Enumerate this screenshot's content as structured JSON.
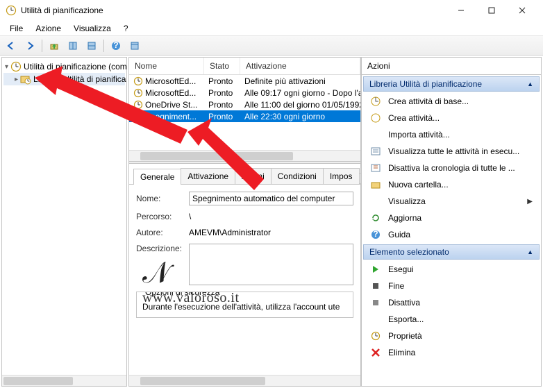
{
  "window": {
    "title": "Utilità di pianificazione"
  },
  "menu": {
    "file": "File",
    "azione": "Azione",
    "visualizza": "Visualizza",
    "help": "?"
  },
  "tree": {
    "root": "Utilità di pianificazione (comp",
    "lib": "Libreria Utilità di pianifica"
  },
  "list": {
    "cols": {
      "nome": "Nome",
      "stato": "Stato",
      "attivazione": "Attivazione"
    },
    "rows": [
      {
        "nome": "MicrosoftEd...",
        "stato": "Pronto",
        "attivazione": "Definite più attivazioni"
      },
      {
        "nome": "MicrosoftEd...",
        "stato": "Pronto",
        "attivazione": "Alle 09:17 ogni giorno - Dopo l'a"
      },
      {
        "nome": "OneDrive St...",
        "stato": "Pronto",
        "attivazione": "Alle 11:00 del giorno 01/05/1992"
      },
      {
        "nome": "Spegniment...",
        "stato": "Pronto",
        "attivazione": "Alle 22:30 ogni giorno"
      }
    ]
  },
  "tabs": {
    "generale": "Generale",
    "attivazione": "Attivazione",
    "azioni": "Azioni",
    "condizioni": "Condizioni",
    "impostazioni": "Impos"
  },
  "form": {
    "nome_label": "Nome:",
    "nome_value": "Spegnimento automatico del computer",
    "percorso_label": "Percorso:",
    "percorso_value": "\\",
    "autore_label": "Autore:",
    "autore_value": "AMEVM\\Administrator",
    "descrizione_label": "Descrizione:",
    "group_sicurezza": "Opzioni di sicurezza",
    "sicurezza_text": "Durante l'esecuzione dell'attività, utilizza l'account ute"
  },
  "actions": {
    "title": "Azioni",
    "group1": "Libreria Utilità di pianificazione",
    "items1": [
      "Crea attività di base...",
      "Crea attività...",
      "Importa attività...",
      "Visualizza tutte le attività in esecu...",
      "Disattiva la cronologia di tutte le ...",
      "Nuova cartella...",
      "Visualizza",
      "Aggiorna",
      "Guida"
    ],
    "group2": "Elemento selezionato",
    "items2": [
      "Esegui",
      "Fine",
      "Disattiva",
      "Esporta...",
      "Proprietà",
      "Elimina"
    ]
  },
  "watermark": {
    "url": "www.valoroso.it"
  }
}
